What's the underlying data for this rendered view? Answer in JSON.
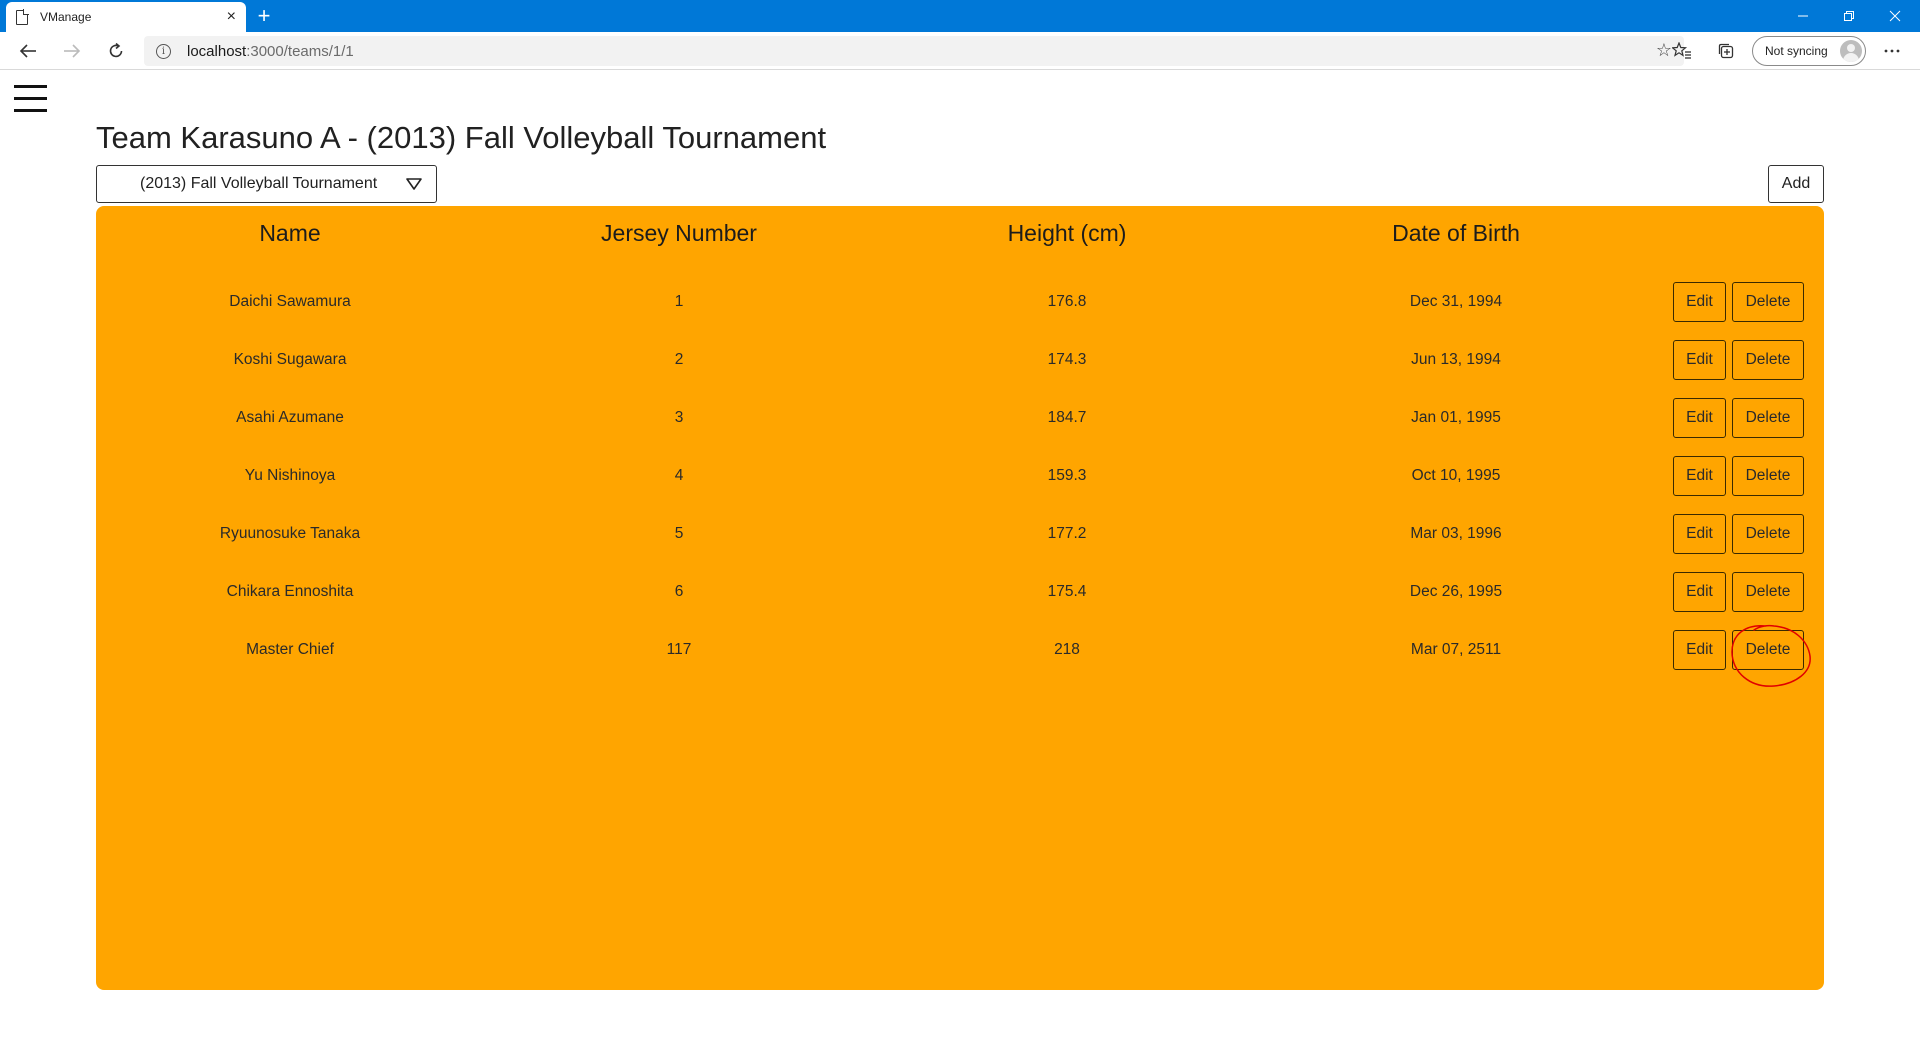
{
  "browser": {
    "tab_title": "VManage",
    "tab_close": "×",
    "new_tab": "+",
    "url_host": "localhost",
    "url_path": ":3000/teams/1/1",
    "sync_label": "Not syncing",
    "icons": [
      "page-icon",
      "back-arrow-icon",
      "forward-arrow-icon",
      "refresh-icon",
      "info-icon",
      "star-icon",
      "favorites-icon",
      "collections-icon",
      "avatar-icon",
      "more-icon"
    ]
  },
  "header": {
    "title": "Team Karasuno A - (2013) Fall Volleyball Tournament"
  },
  "tournament_select": {
    "selected": "(2013) Fall Volleyball Tournament"
  },
  "toolbar": {
    "add_label": "Add"
  },
  "table": {
    "columns": [
      "Name",
      "Jersey Number",
      "Height (cm)",
      "Date of Birth"
    ],
    "rows": [
      {
        "name": "Daichi Sawamura",
        "jersey": "1",
        "height": "176.8",
        "dob": "Dec 31, 1994"
      },
      {
        "name": "Koshi Sugawara",
        "jersey": "2",
        "height": "174.3",
        "dob": "Jun 13, 1994"
      },
      {
        "name": "Asahi Azumane",
        "jersey": "3",
        "height": "184.7",
        "dob": "Jan 01, 1995"
      },
      {
        "name": "Yu Nishinoya",
        "jersey": "4",
        "height": "159.3",
        "dob": "Oct 10, 1995"
      },
      {
        "name": "Ryuunosuke Tanaka",
        "jersey": "5",
        "height": "177.2",
        "dob": "Mar 03, 1996"
      },
      {
        "name": "Chikara Ennoshita",
        "jersey": "6",
        "height": "175.4",
        "dob": "Dec 26, 1995"
      },
      {
        "name": "Master Chief",
        "jersey": "117",
        "height": "218",
        "dob": "Mar 07, 2511"
      }
    ],
    "edit_label": "Edit",
    "delete_label": "Delete"
  },
  "colors": {
    "titlebar": "#0078d7",
    "panel": "#ffa500",
    "annotation": "#e00000"
  }
}
